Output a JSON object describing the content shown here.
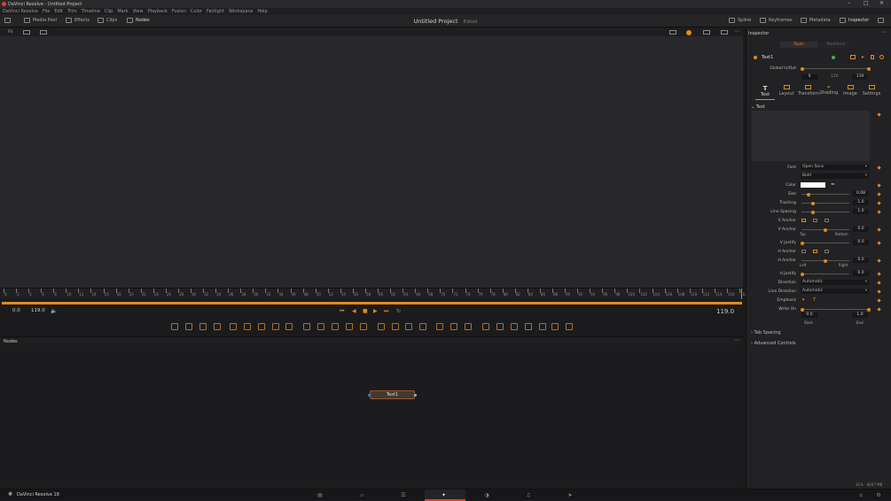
{
  "window": {
    "title": "DaVinci Resolve - Untitled Project"
  },
  "menu": [
    "DaVinci Resolve",
    "File",
    "Edit",
    "Trim",
    "Timeline",
    "Clip",
    "Mark",
    "View",
    "Playback",
    "Fusion",
    "Color",
    "Fairlight",
    "Workspace",
    "Help"
  ],
  "toolbar": {
    "media_pool": "Media Pool",
    "effects": "Effects",
    "clips": "Clips",
    "nodes": "Nodes",
    "project": "Untitled Project",
    "edited": "Edited",
    "spline": "Spline",
    "keyframes": "Keyframes",
    "metadata": "Metadata",
    "inspector": "Inspector"
  },
  "viewer": {
    "fit": "Fit",
    "timecode_left": "0.0",
    "timecode_right": "119.0",
    "current": "119.0"
  },
  "ruler": [
    "0",
    "2",
    "4",
    "6",
    "8",
    "10",
    "12",
    "14",
    "16",
    "18",
    "20",
    "22",
    "24",
    "26",
    "28",
    "30",
    "32",
    "34",
    "36",
    "38",
    "40",
    "42",
    "44",
    "46",
    "48",
    "50",
    "52",
    "54",
    "56",
    "58",
    "60",
    "62",
    "64",
    "66",
    "68",
    "70",
    "72",
    "74",
    "76",
    "78",
    "80",
    "82",
    "84",
    "86",
    "88",
    "90",
    "92",
    "94",
    "96",
    "98",
    "100",
    "102",
    "104",
    "106",
    "108",
    "110",
    "112",
    "114",
    "116",
    "118"
  ],
  "nodes": {
    "header": "Nodes",
    "node_label": "Text1"
  },
  "inspector": {
    "title": "Inspector",
    "tab_tools": "Tools",
    "tab_modifiers": "Modifiers",
    "node_name": "Text1",
    "global_in_out": "Global In/Out",
    "global_in": "0",
    "global_mid": "120",
    "global_out": "119",
    "subtabs": [
      "Text",
      "Layout",
      "Transform",
      "Shading",
      "Image",
      "Settings"
    ],
    "section_text": "Text",
    "font_label": "Font",
    "font": "Open Sans",
    "style": "Bold",
    "color_label": "Color",
    "size_label": "Size",
    "size": "0.08",
    "tracking_label": "Tracking",
    "tracking": "1.0",
    "line_spacing_label": "Line Spacing",
    "line_spacing": "1.0",
    "v_anchor_label": "V Anchor",
    "v_anchor2_label": "V Anchor",
    "v_anchor_val": "0.0",
    "top": "Top",
    "bottom": "Bottom",
    "v_justify_label": "V Justify",
    "v_justify": "0.0",
    "h_anchor_label": "H Anchor",
    "h_anchor2_label": "H Anchor",
    "h_anchor_val": "0.0",
    "left": "Left",
    "right": "Right",
    "h_justify_label": "H Justify",
    "h_justify": "0.0",
    "direction_label": "Direction",
    "direction": "Automatic",
    "line_direction_label": "Line Direction",
    "line_direction": "Automatic",
    "emphasis_label": "Emphasis",
    "write_on_label": "Write On",
    "write_start": "0.0",
    "write_end": "1.0",
    "start": "Start",
    "end": "End",
    "tab_spacing": "Tab Spacing",
    "advanced_controls": "Advanced Controls"
  },
  "status": {
    "app": "DaVinci Resolve 18",
    "usage": "31% · 8047 MB"
  },
  "colors": {
    "accent": "#e08a1e",
    "bg": "#1b1b1d"
  }
}
